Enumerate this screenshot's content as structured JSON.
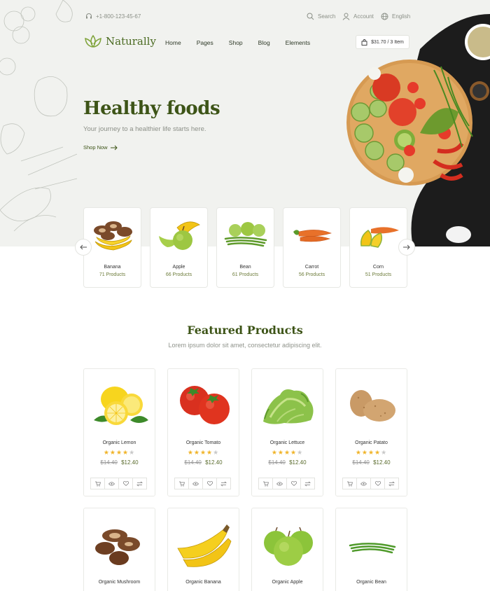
{
  "topbar": {
    "phone": "+1-800-123-45-67",
    "search": "Search",
    "account": "Account",
    "language": "English"
  },
  "brand": {
    "name": "Naturally"
  },
  "nav": [
    "Home",
    "Pages",
    "Shop",
    "Blog",
    "Elements"
  ],
  "cart": {
    "label": "$31.70 / 3 Item"
  },
  "hero": {
    "title": "Healthy foods",
    "subtitle": "Your journey to a healthier life starts here.",
    "cta": "Shop Now"
  },
  "categories": [
    {
      "name": "Banana",
      "count": "71 Products",
      "icon": "banana"
    },
    {
      "name": "Apple",
      "count": "66 Products",
      "icon": "apple"
    },
    {
      "name": "Bean",
      "count": "61 Products",
      "icon": "bean"
    },
    {
      "name": "Carrot",
      "count": "56 Products",
      "icon": "carrot"
    },
    {
      "name": "Corn",
      "count": "51 Products",
      "icon": "corn"
    }
  ],
  "featured": {
    "title": "Featured Products",
    "subtitle": "Lorem ipsum dolor sit amet, consectetur adipiscing elit."
  },
  "products": [
    {
      "name": "Organic Lemon",
      "old_price": "$14.40",
      "price": "$12.40",
      "rating": 4,
      "icon": "lemon"
    },
    {
      "name": "Organic Tomato",
      "old_price": "$14.40",
      "price": "$12.40",
      "rating": 4,
      "icon": "tomato"
    },
    {
      "name": "Organic Lettuce",
      "old_price": "$14.40",
      "price": "$12.40",
      "rating": 4,
      "icon": "lettuce"
    },
    {
      "name": "Organic Patato",
      "old_price": "$14.40",
      "price": "$12.40",
      "rating": 4,
      "icon": "potato"
    }
  ],
  "products_row2": [
    {
      "name": "Organic Mushroom",
      "icon": "mushroom"
    },
    {
      "name": "Organic Banana",
      "icon": "banana"
    },
    {
      "name": "Organic Apple",
      "icon": "apple"
    },
    {
      "name": "Organic Bean",
      "icon": "bean"
    }
  ],
  "colors": {
    "brand_green": "#3d5417",
    "accent_olive": "#6e7d3c",
    "star": "#f0b429",
    "hero_bg": "#f1f2ef"
  }
}
